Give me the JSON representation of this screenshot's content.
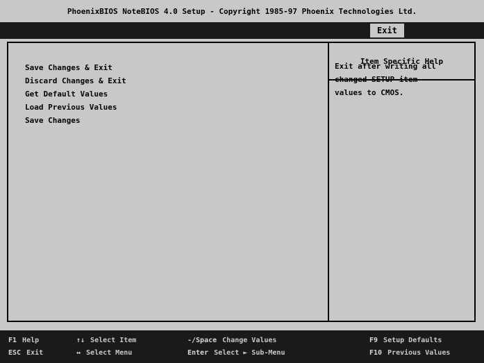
{
  "title": "PhoenixBIOS NoteBIOS 4.0 Setup - Copyright 1985-97 Phoenix Technologies Ltd.",
  "menu": {
    "active_tab": "Exit"
  },
  "items": [
    "Save Changes & Exit",
    "Discard Changes & Exit",
    "Get Default Values",
    "Load Previous Values",
    "Save Changes"
  ],
  "help": {
    "header": "Item Specific Help",
    "lines": [
      "Exit after writing all",
      "changed SETUP item",
      "values to CMOS."
    ]
  },
  "footer": {
    "row1": [
      {
        "key": "F1",
        "desc": "Help"
      },
      {
        "key": "↑↓",
        "desc": "Select Item"
      },
      {
        "key": "-/Space",
        "desc": "Change Values"
      },
      {
        "key": "F9",
        "desc": "Setup Defaults"
      }
    ],
    "row2": [
      {
        "key": "ESC",
        "desc": "Exit"
      },
      {
        "key": "↔",
        "desc": "Select Menu"
      },
      {
        "key": "Enter",
        "desc": "Select ► Sub-Menu"
      },
      {
        "key": "F10",
        "desc": "Previous Values"
      }
    ]
  },
  "colors": {
    "background": "#c8c8c8",
    "bar": "#1a1a1a",
    "text": "#000000"
  }
}
